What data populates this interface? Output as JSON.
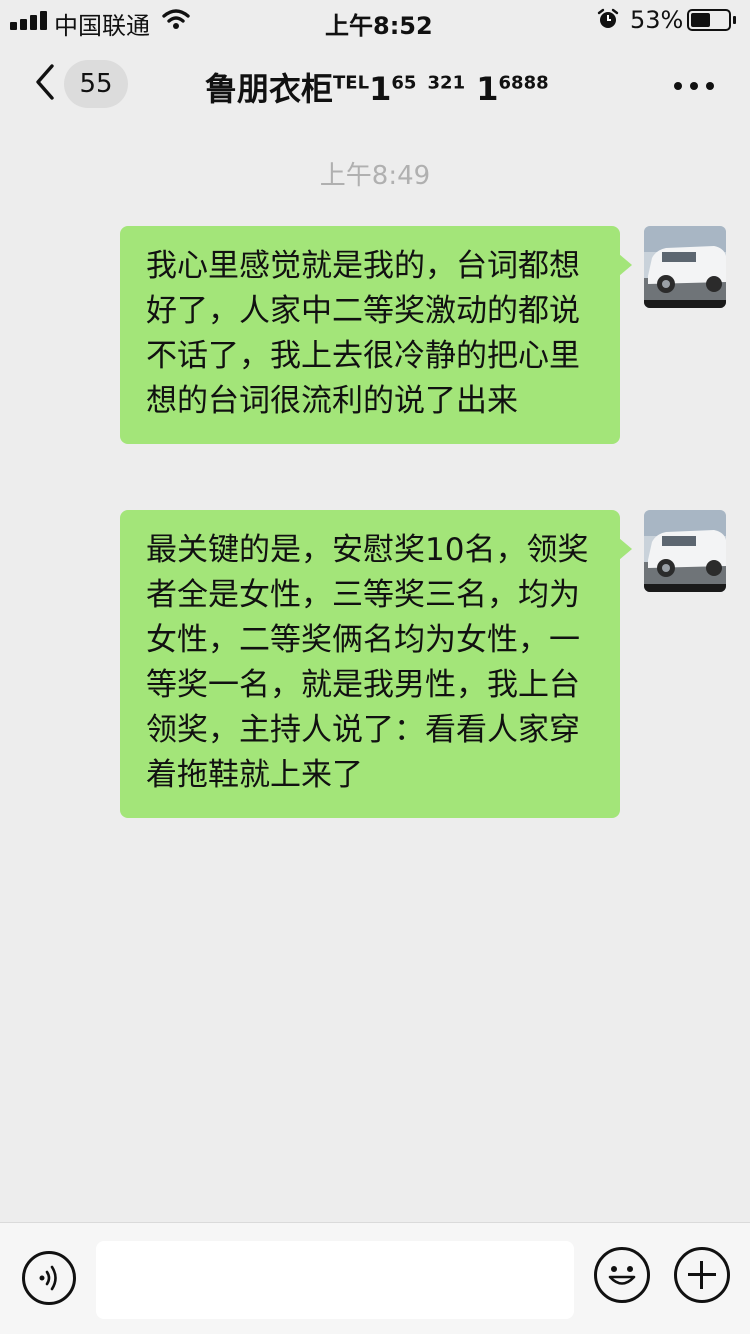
{
  "status_bar": {
    "carrier": "中国联通",
    "time": "上午8:52",
    "battery_percent": "53%",
    "battery_level": 0.53,
    "icons": [
      "signal-icon",
      "wifi-icon",
      "alarm-icon",
      "battery-icon"
    ]
  },
  "header": {
    "unread_count": "55",
    "title_main": "鲁朋衣柜",
    "title_tel": "TEL",
    "title_1": "1",
    "title_65": "65",
    "title_321": "321",
    "title_1b": "1",
    "title_6888": "6888",
    "icons": [
      "back-chevron-icon",
      "more-dots-icon"
    ]
  },
  "chat": {
    "timestamp": "上午8:49",
    "messages": [
      {
        "sender": "self",
        "text": "我心里感觉就是我的，台词都想好了，人家中二等奖激动的都说不话了，我上去很冷静的把心里想的台词很流利的说了出来"
      },
      {
        "sender": "self",
        "text": "最关键的是，安慰奖10名，领奖者全是女性，三等奖三名，均为女性，二等奖俩名均为女性，一等奖一名，就是我男性，我上台领奖，主持人说了：看看人家穿着拖鞋就上来了"
      }
    ]
  },
  "input_bar": {
    "input_value": "",
    "icons": [
      "voice-icon",
      "emoji-icon",
      "add-icon"
    ]
  },
  "colors": {
    "background": "#ededed",
    "bubble_self": "#a3e579",
    "timestamp_text": "#b0b0b0",
    "badge_bg": "#dcdcdc"
  }
}
